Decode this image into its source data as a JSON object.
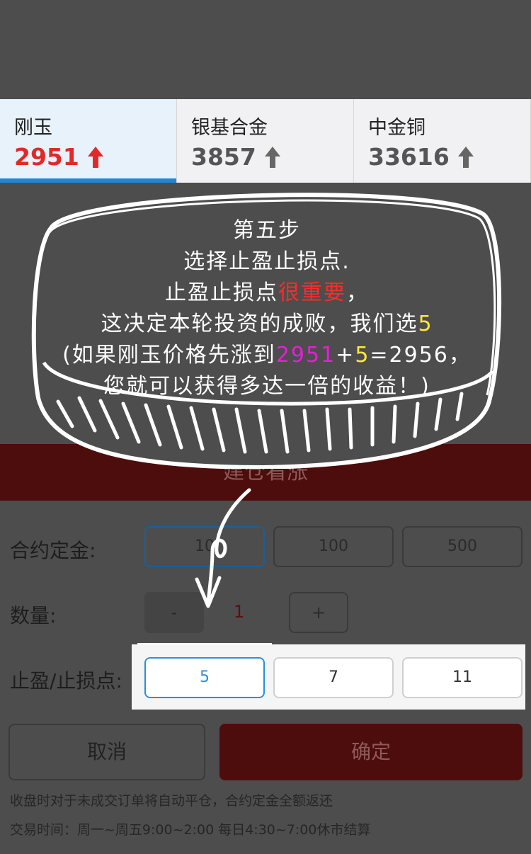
{
  "products": [
    {
      "name": "刚玉",
      "price": "2951",
      "active": true
    },
    {
      "name": "银基合金",
      "price": "3857",
      "active": false
    },
    {
      "name": "中金铜",
      "price": "33616",
      "active": false
    }
  ],
  "tutorial": {
    "line1": "第五步",
    "line2": "选择止盈止损点.",
    "line3_a": "止盈止损点",
    "line3_b": "很重要",
    "line3_c": "，",
    "line4_a": "这决定本轮投资的成败，我们选",
    "line4_b": "5",
    "line5_a": "(如果刚玉价格先涨到",
    "line5_b": "2951",
    "line5_c": "+",
    "line5_d": "5",
    "line5_e": "=2956，",
    "line6": "您就可以获得多达一倍的收益！)"
  },
  "banner": "建仓看涨",
  "deposit": {
    "label": "合约定金:",
    "options": [
      "10",
      "100",
      "500"
    ]
  },
  "quantity": {
    "label": "数量:",
    "minus": "-",
    "value": "1",
    "plus": "+"
  },
  "tpsl": {
    "label": "止盈/止损点:",
    "options": [
      "5",
      "7",
      "11"
    ]
  },
  "buttons": {
    "cancel": "取消",
    "confirm": "确定"
  },
  "notes": {
    "line1": "收盘时对于未成交订单将自动平仓，合约定金全额返还",
    "line2": "交易时间：周一~周五9:00~2:00 每日4:30~7:00休市结算"
  },
  "colors": {
    "up_red": "#e02a2a",
    "accent_blue": "#1e88d8",
    "tutorial_red": "#ff2a2a",
    "tutorial_yellow": "#ffe93a",
    "tutorial_magenta": "#e61ed8"
  }
}
